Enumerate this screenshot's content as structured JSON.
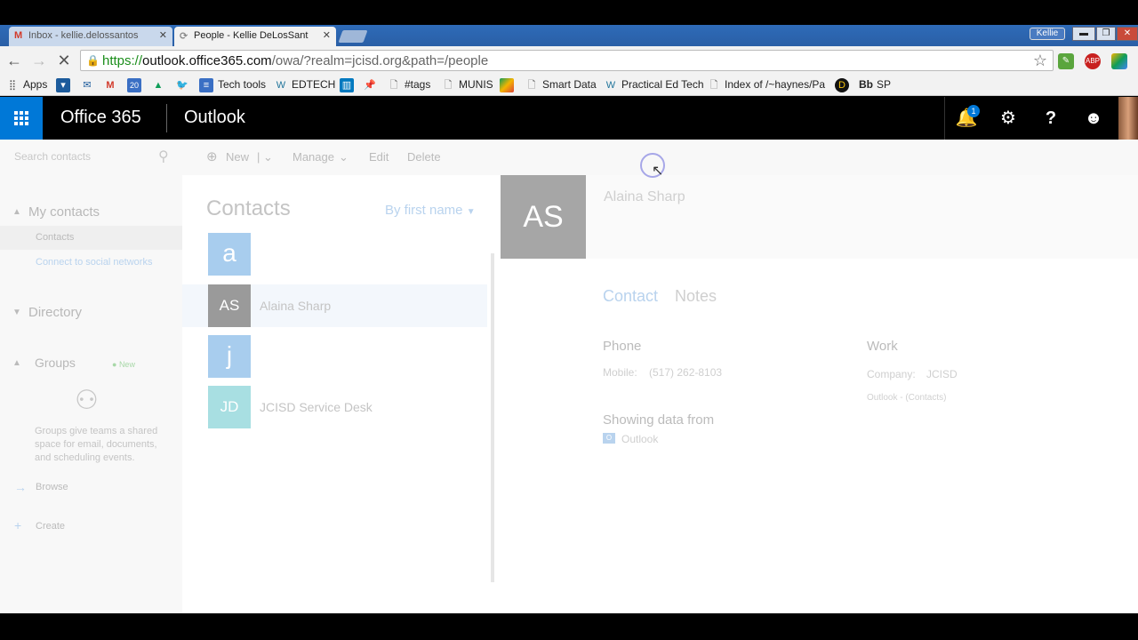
{
  "browser": {
    "tabs": [
      {
        "label": "Inbox - kellie.delossantos",
        "icon": "M"
      },
      {
        "label": "People - Kellie DeLosSant",
        "icon": "⟳"
      }
    ],
    "profile": "Kellie",
    "window_buttons": {
      "minimize": "▬",
      "restore": "❐",
      "close": "✕"
    },
    "url": {
      "scheme": "https://",
      "host": "outlook.office365.com",
      "path": "/owa/?realm=jcisd.org&path=/people"
    },
    "extensions": [
      "evernote-icon",
      "adblock-icon",
      "google-drive-icon"
    ],
    "adblock_label": "ABP"
  },
  "bookmarks": [
    {
      "label": "Apps",
      "icon": "apps-icon"
    },
    {
      "label": "",
      "icon": "blog-icon"
    },
    {
      "label": "",
      "icon": "mail-icon"
    },
    {
      "label": "",
      "icon": "gmail-icon"
    },
    {
      "label": "20",
      "icon": "calendar-icon"
    },
    {
      "label": "",
      "icon": "drive-icon"
    },
    {
      "label": "",
      "icon": "twitter-icon"
    },
    {
      "label": "Tech tools",
      "icon": "docs-icon"
    },
    {
      "label": "EDTECH",
      "icon": "wordpress-icon"
    },
    {
      "label": "",
      "icon": "trello-icon"
    },
    {
      "label": "",
      "icon": "pin-icon"
    },
    {
      "label": "#tags",
      "icon": "page-icon"
    },
    {
      "label": "MUNIS",
      "icon": "page-icon"
    },
    {
      "label": "",
      "icon": "maps-icon"
    },
    {
      "label": "Smart Data",
      "icon": "page-icon"
    },
    {
      "label": "Practical Ed Tech",
      "icon": "wordpress-icon"
    },
    {
      "label": "Index of /~haynes/Pa",
      "icon": "page-icon"
    },
    {
      "label": "",
      "icon": "d-icon"
    },
    {
      "label": "SP",
      "icon": "blackboard-icon"
    }
  ],
  "bb_label": "Bb",
  "suite": {
    "brand": "Office 365",
    "app": "Outlook",
    "notification_count": "1",
    "icons": {
      "bell": "🔔",
      "gear": "⚙",
      "help": "?",
      "smiley": "☻"
    }
  },
  "commands": {
    "search_placeholder": "Search contacts",
    "new": "New",
    "manage": "Manage",
    "edit": "Edit",
    "delete": "Delete"
  },
  "leftnav": {
    "my_contacts": "My contacts",
    "contacts": "Contacts",
    "connect": "Connect to social networks",
    "directory": "Directory",
    "groups": "Groups",
    "groups_new": "New",
    "groups_desc": "Groups give teams a shared space for email, documents, and scheduling events.",
    "browse": "Browse",
    "create": "Create"
  },
  "list": {
    "title": "Contacts",
    "sort": "By first name",
    "entries": [
      {
        "type": "letter",
        "text": "a"
      },
      {
        "type": "contact",
        "initials": "AS",
        "name": "Alaina Sharp",
        "color": "#9a9a9a",
        "selected": true
      },
      {
        "type": "letter",
        "text": "j"
      },
      {
        "type": "contact",
        "initials": "JD",
        "name": "JCISD Service Desk",
        "color": "#a8dfe2",
        "selected": false
      }
    ]
  },
  "detail": {
    "initials": "AS",
    "name": "Alaina Sharp",
    "tabs": [
      "Contact",
      "Notes"
    ],
    "phone_heading": "Phone",
    "mobile_label": "Mobile:",
    "mobile_value": "(517) 262-8103",
    "work_heading": "Work",
    "company_label": "Company:",
    "company_value": "JCISD",
    "work_source": "Outlook - (Contacts)",
    "showing_heading": "Showing data from",
    "source": "Outlook"
  },
  "colors": {
    "accent": "#0078d7",
    "suite_bg": "#000000",
    "chrome_tab": "#2a5fa6"
  }
}
